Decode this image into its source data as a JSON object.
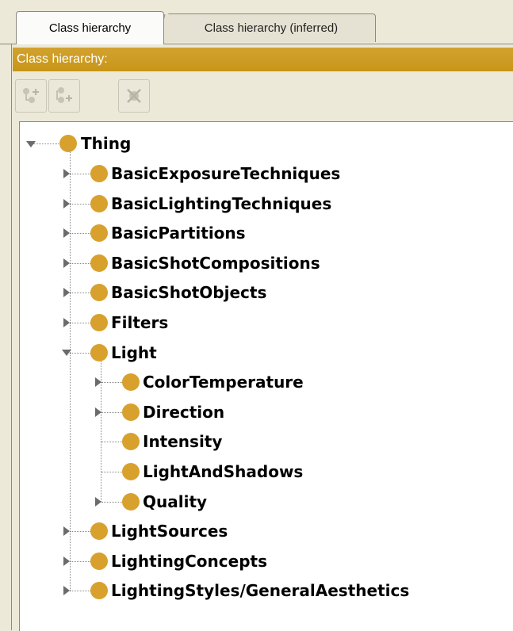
{
  "tabs": [
    {
      "label": "Class hierarchy",
      "active": true
    },
    {
      "label": "Class hierarchy (inferred)",
      "active": false
    }
  ],
  "panel": {
    "title": "Class hierarchy:",
    "accent_color": "#c99a1f"
  },
  "toolbar": {
    "buttons": [
      {
        "icon": "add-subclass-icon"
      },
      {
        "icon": "add-sibling-class-icon"
      },
      {
        "icon": "delete-class-icon"
      }
    ]
  },
  "tree": {
    "root": {
      "label": "Thing",
      "expanded": true
    },
    "items": [
      {
        "label": "BasicExposureTechniques",
        "level": 1,
        "has_children": true,
        "expanded": false
      },
      {
        "label": "BasicLightingTechniques",
        "level": 1,
        "has_children": true,
        "expanded": false
      },
      {
        "label": "BasicPartitions",
        "level": 1,
        "has_children": true,
        "expanded": false
      },
      {
        "label": "BasicShotCompositions",
        "level": 1,
        "has_children": true,
        "expanded": false
      },
      {
        "label": "BasicShotObjects",
        "level": 1,
        "has_children": true,
        "expanded": false
      },
      {
        "label": "Filters",
        "level": 1,
        "has_children": true,
        "expanded": false
      },
      {
        "label": "Light",
        "level": 1,
        "has_children": true,
        "expanded": true
      },
      {
        "label": "ColorTemperature",
        "level": 2,
        "has_children": true,
        "expanded": false
      },
      {
        "label": "Direction",
        "level": 2,
        "has_children": true,
        "expanded": false
      },
      {
        "label": "Intensity",
        "level": 2,
        "has_children": false,
        "expanded": false
      },
      {
        "label": "LightAndShadows",
        "level": 2,
        "has_children": false,
        "expanded": false
      },
      {
        "label": "Quality",
        "level": 2,
        "has_children": true,
        "expanded": false
      },
      {
        "label": "LightSources",
        "level": 1,
        "has_children": true,
        "expanded": false
      },
      {
        "label": "LightingConcepts",
        "level": 1,
        "has_children": true,
        "expanded": false
      },
      {
        "label": "LightingStyles/GeneralAesthetics",
        "level": 1,
        "has_children": true,
        "expanded": false
      }
    ],
    "node_color": "#d8a12e"
  }
}
